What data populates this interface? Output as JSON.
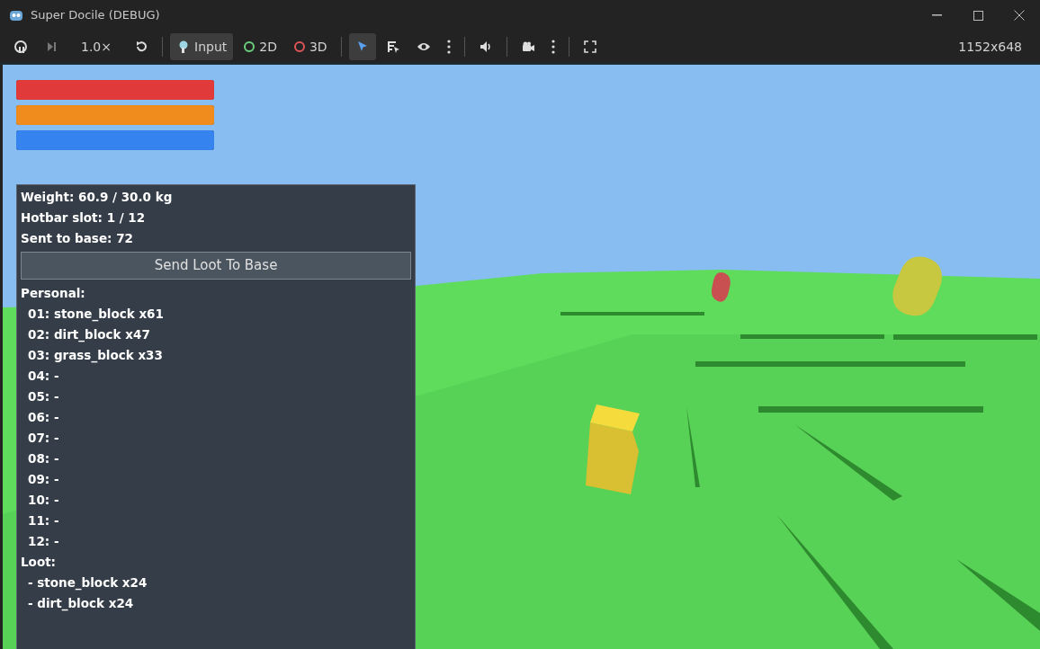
{
  "window": {
    "title": "Super Docile (DEBUG)"
  },
  "toolbar": [
    {
      "kind": "icon",
      "selected": false
    },
    {
      "kind": "icon",
      "selected": false
    },
    {
      "kind": "text",
      "label": "1.0×",
      "selected": false
    },
    {
      "kind": "icon",
      "selected": false
    },
    {
      "kind": "sep"
    },
    {
      "kind": "icon-text",
      "label": "Input",
      "selected": true
    },
    {
      "kind": "ring",
      "label": "2D",
      "color": "#6bd17d",
      "selected": false
    },
    {
      "kind": "ring",
      "label": "3D",
      "color": "#e05555",
      "selected": false
    },
    {
      "kind": "sep"
    },
    {
      "kind": "icon",
      "selected": true
    },
    {
      "kind": "icon",
      "selected": false
    },
    {
      "kind": "icon",
      "selected": false
    },
    {
      "kind": "icon",
      "selected": false
    },
    {
      "kind": "sep"
    },
    {
      "kind": "icon",
      "selected": false
    },
    {
      "kind": "sep"
    },
    {
      "kind": "icon",
      "selected": false
    },
    {
      "kind": "icon",
      "selected": false
    },
    {
      "kind": "sep"
    },
    {
      "kind": "icon",
      "selected": false
    }
  ],
  "resolution": "1152x648",
  "bars": [
    {
      "color": "#e03a3a",
      "level": 1
    },
    {
      "color": "#f08c1e",
      "level": 1
    },
    {
      "color": "#3583ee",
      "level": 1
    }
  ],
  "panel": {
    "stats": [
      "Weight: 60.9 / 30.0 kg",
      "Hotbar slot: 1 / 12",
      "Sent to base: 72"
    ],
    "button": "Send Loot To Base",
    "personal_heading": "Personal:",
    "personal": [
      "01: stone_block x61",
      "02: dirt_block x47",
      "03: grass_block x33",
      "04: -",
      "05: -",
      "06: -",
      "07: -",
      "08: -",
      "09: -",
      "10: -",
      "11: -",
      "12: -"
    ],
    "loot_heading": "Loot:",
    "loot": [
      "- stone_block x24",
      "- dirt_block x24"
    ]
  }
}
